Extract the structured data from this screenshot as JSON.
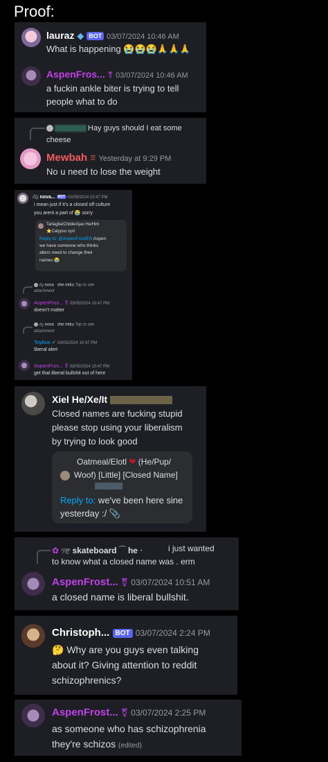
{
  "header": {
    "title": "Proof:"
  },
  "card1": {
    "m1": {
      "name": "lauraz",
      "bot": "BOT",
      "ts": "03/07/2024 10:46 AM",
      "text": "What is happening 😭😭😭🙏🙏🙏"
    },
    "m2": {
      "name": "AspenFros...",
      "ts": "03/07/2024 10:46 AM",
      "text1": "a fuckin ankle biter is trying to tell",
      "text2": "people what to do"
    }
  },
  "card2": {
    "reply": {
      "text1": "Hay guys should I eat some",
      "text2": "cheese"
    },
    "m1": {
      "name": "Mewbah",
      "ts": "Yesterday at 9:29 PM",
      "text": "No u need to lose the weight"
    }
  },
  "card3": {
    "m1": {
      "name": "nova...",
      "bot": "BOT",
      "ts": "03/05/2024 10:47 PM",
      "text1": "i mean just if it's a closed off culture",
      "text2": "you arent a part of 😭 sorry"
    },
    "embed": {
      "author": "Tartaglia/Childe/Ajax He/Him",
      "author2": "⭐Calypso sys!",
      "reply_label": "Reply to:",
      "reply_target": "@AspenFrostEN",
      "line1_rest": " Aspen",
      "line2": "we have someone who thinks",
      "line3": "alters need to change their",
      "line4": "names 😭"
    },
    "r1": {
      "text": "nova",
      "who": "she miku",
      "tap": "Tap to see",
      "att": "attachment"
    },
    "m2": {
      "name": "AspenFros...",
      "ts": "03/05/2024 10:47 PM",
      "text": "doesn't matter"
    },
    "r2": {
      "text": "nova",
      "who": "she miku",
      "tap": "Tap to see",
      "att": "attachment"
    },
    "m3": {
      "name": "Toybox",
      "ts": "03/05/2024 10:47 PM",
      "text": "liberal alert"
    },
    "m4": {
      "name": "AspenFros...",
      "ts": "03/05/2024 10:47 PM",
      "text": "get that liberal bullshit out of here"
    }
  },
  "card4": {
    "m1": {
      "name": "Xiel He/Xe/It",
      "text1": "Closed names are fucking stupid",
      "text2": "please stop using your liberalism",
      "text3": "by trying to look good"
    },
    "embed": {
      "author1": "Oatmeal/Elotl",
      "author1b": "(He/Pup/",
      "author2": "Woof) [Little] [Closed Name]",
      "reply_label": "Reply to:",
      "reply_text1": " we've been here sine",
      "reply_text2": "yesterday :/ 📎"
    }
  },
  "card5": {
    "reply": {
      "text1": "skateboard",
      "text1b": "he",
      "text1c": "i just wanted",
      "text2": "to know what a closed name was . erm"
    },
    "m1": {
      "name": "AspenFrost...",
      "ts": "03/07/2024 10:51 AM",
      "text": "a closed name is liberal bullshit."
    }
  },
  "card6": {
    "m1": {
      "name": "Christoph...",
      "bot": "BOT",
      "ts": "03/07/2024 2:24 PM",
      "text1": "🤔 Why are you guys even talking",
      "text2": "about it? Giving attention to reddit",
      "text3": "schizophrenics?"
    }
  },
  "card7": {
    "m1": {
      "name": "AspenFrost...",
      "ts": "03/07/2024 2:25 PM",
      "text1": "as someone who has schizophrenia",
      "text2": "they're schizos",
      "edited": "(edited)"
    }
  },
  "colors": {
    "background": "#000000",
    "card": "#1e1f24",
    "aspen": "#c040e8",
    "mewbah": "#f05b5b",
    "link": "#00a8fc",
    "bot": "#5865f2"
  }
}
